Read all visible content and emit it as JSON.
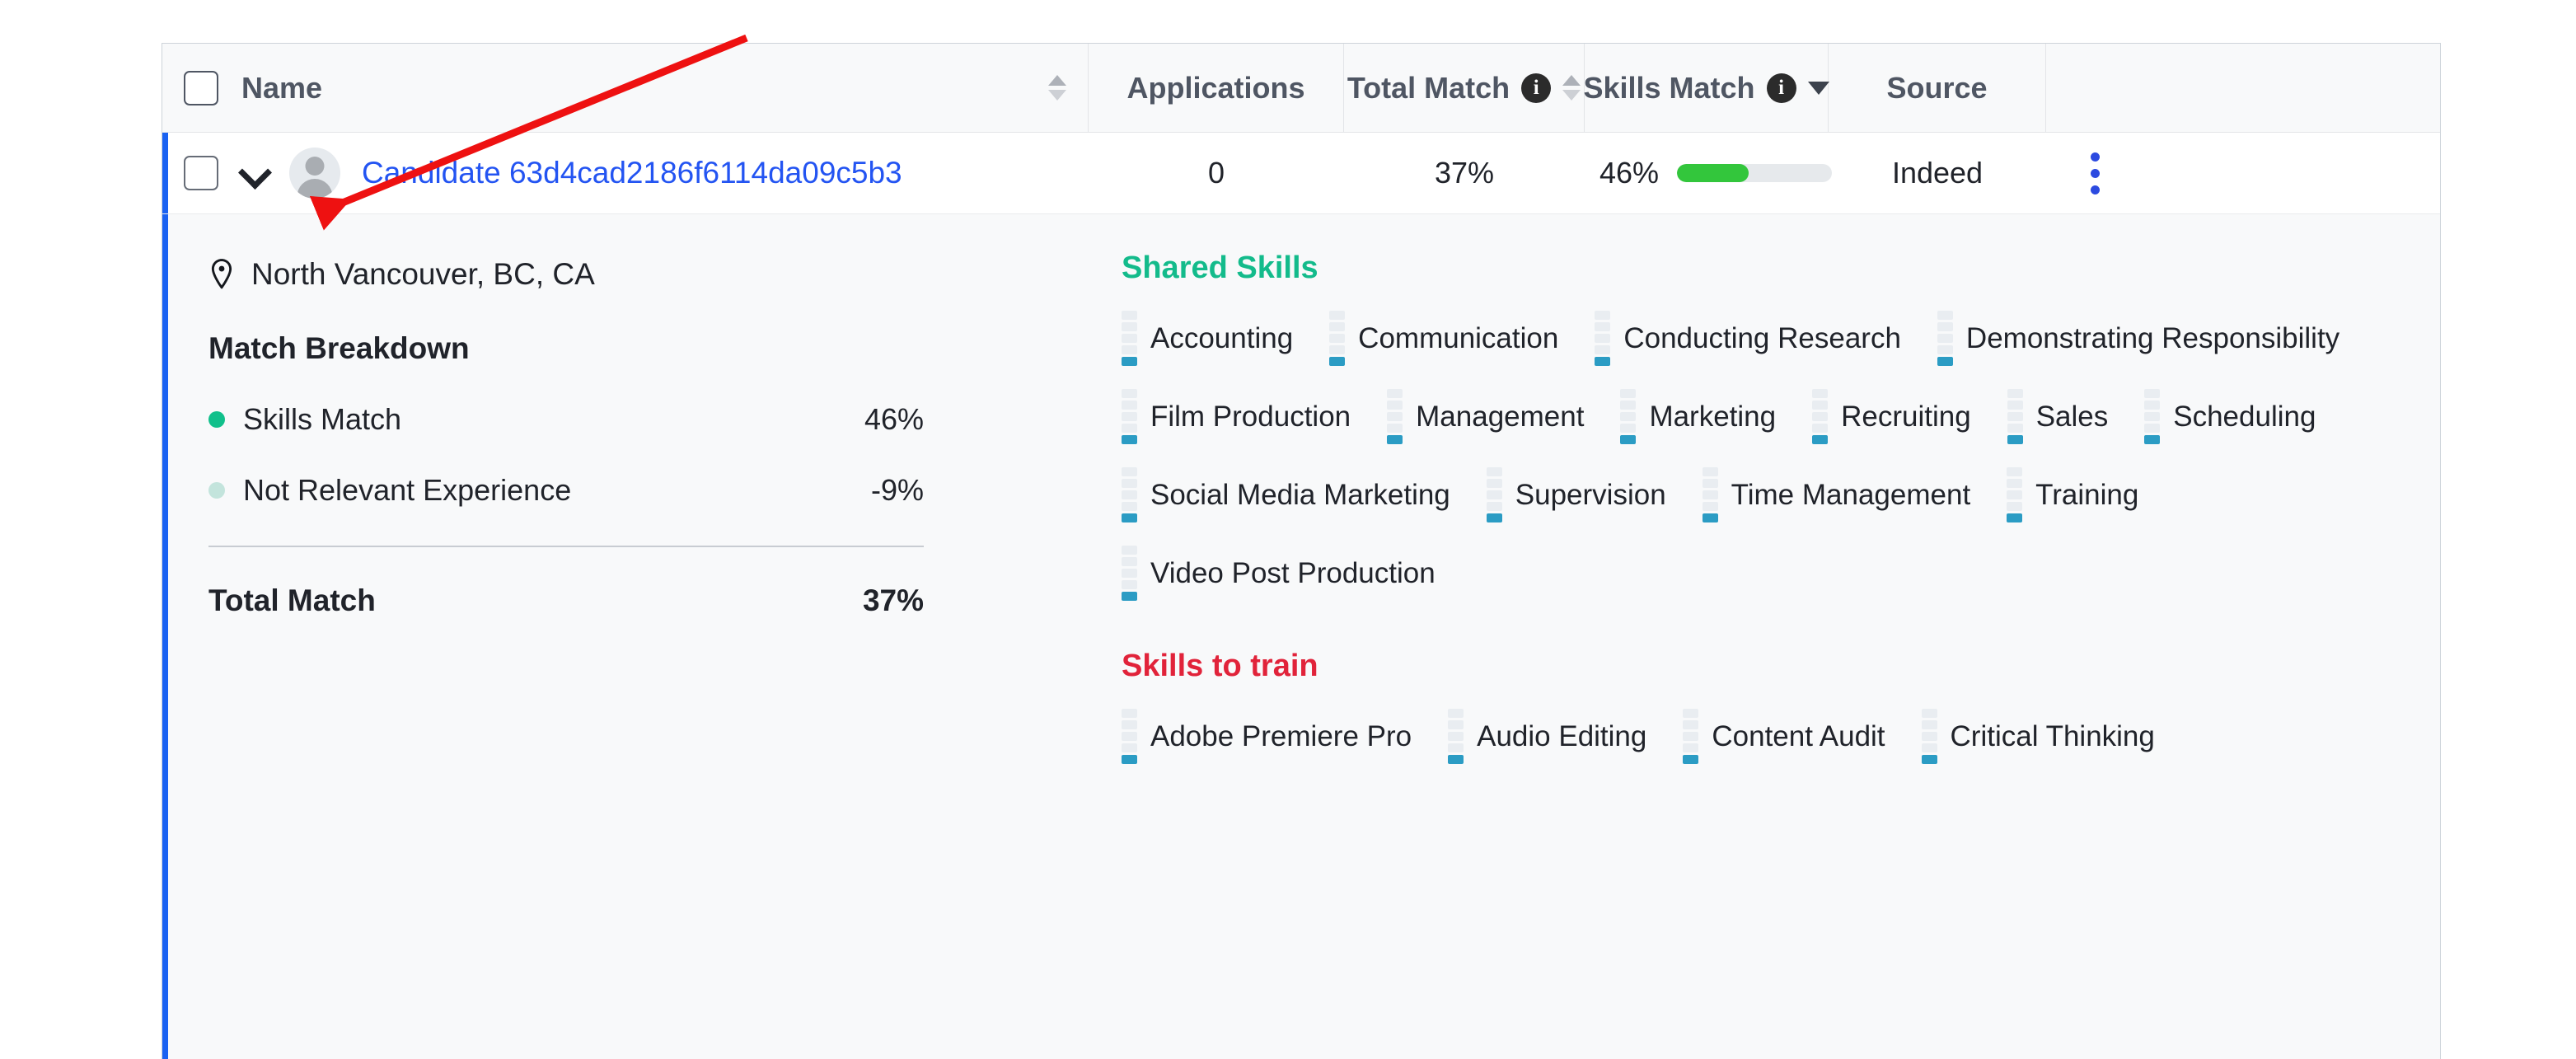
{
  "table": {
    "columns": [
      {
        "id": "name",
        "label": "Name",
        "sort": "updown",
        "info": false
      },
      {
        "id": "applications",
        "label": "Applications",
        "sort": "none",
        "info": false
      },
      {
        "id": "total_match",
        "label": "Total Match",
        "sort": "updown",
        "info": true
      },
      {
        "id": "skills_match",
        "label": "Skills Match",
        "sort": "desc",
        "info": true
      },
      {
        "id": "source",
        "label": "Source",
        "sort": "none",
        "info": false
      }
    ],
    "row": {
      "name": "Candidate 63d4cad2186f6114da09c5b3",
      "applications": "0",
      "total_match": "37%",
      "skills_match": "46%",
      "skills_match_pct": 46,
      "source": "Indeed"
    }
  },
  "detail": {
    "location": "North Vancouver, BC, CA",
    "match_breakdown": {
      "title": "Match Breakdown",
      "rows": [
        {
          "label": "Skills Match",
          "value": "46%",
          "dot": "#11c08b"
        },
        {
          "label": "Not Relevant Experience",
          "value": "-9%",
          "dot": "#c3e4dc"
        }
      ],
      "total_label": "Total Match",
      "total_value": "37%"
    },
    "shared_skills": {
      "title": "Shared Skills",
      "items": [
        "Accounting",
        "Communication",
        "Conducting Research",
        "Demonstrating Responsibility",
        "Film Production",
        "Management",
        "Marketing",
        "Recruiting",
        "Sales",
        "Scheduling",
        "Social Media Marketing",
        "Supervision",
        "Time Management",
        "Training",
        "Video Post Production"
      ]
    },
    "skills_to_train": {
      "title": "Skills to train",
      "items": [
        "Adobe Premiere Pro",
        "Audio Editing",
        "Content Audit",
        "Critical Thinking"
      ]
    }
  },
  "colors": {
    "accent_bar": "#1a62f2",
    "link": "#2354f2",
    "progress_fill": "#33c63c",
    "shared_heading": "#13bb8b",
    "train_heading": "#e1233a",
    "skill_bar": "#2b9cc4",
    "annotation_arrow": "#ee1111"
  },
  "annotation": {
    "type": "arrow",
    "points_at": "expand-row-chevron"
  }
}
